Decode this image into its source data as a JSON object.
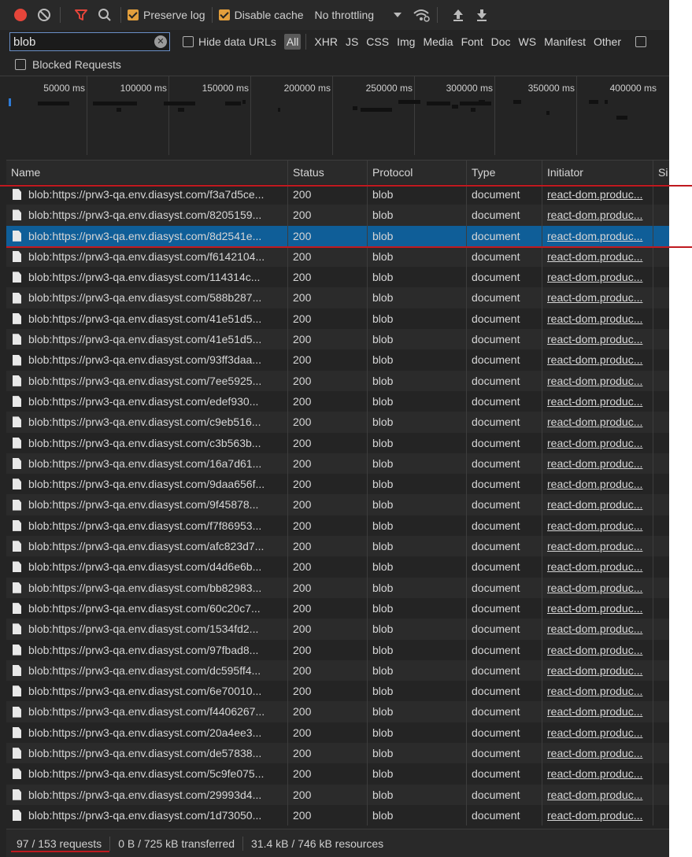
{
  "toolbar": {
    "preserve_log": "Preserve log",
    "disable_cache": "Disable cache",
    "throttling": "No throttling"
  },
  "filter": {
    "value": "blob",
    "hide_data_urls": "Hide data URLs",
    "types": [
      "All",
      "XHR",
      "JS",
      "CSS",
      "Img",
      "Media",
      "Font",
      "Doc",
      "WS",
      "Manifest",
      "Other"
    ],
    "blocked_requests": "Blocked Requests"
  },
  "overview": {
    "ticks": [
      "50000 ms",
      "100000 ms",
      "150000 ms",
      "200000 ms",
      "250000 ms",
      "300000 ms",
      "350000 ms",
      "400000 ms"
    ]
  },
  "columns": {
    "name": "Name",
    "status": "Status",
    "protocol": "Protocol",
    "type": "Type",
    "initiator": "Initiator",
    "size": "Si"
  },
  "rows": [
    {
      "name": "blob:https://prw3-qa.env.diasyst.com/f3a7d5ce...",
      "status": "200",
      "protocol": "blob",
      "type": "document",
      "initiator": "react-dom.produc..."
    },
    {
      "name": "blob:https://prw3-qa.env.diasyst.com/8205159...",
      "status": "200",
      "protocol": "blob",
      "type": "document",
      "initiator": "react-dom.produc..."
    },
    {
      "name": "blob:https://prw3-qa.env.diasyst.com/8d2541e...",
      "status": "200",
      "protocol": "blob",
      "type": "document",
      "initiator": "react-dom.produc..."
    },
    {
      "name": "blob:https://prw3-qa.env.diasyst.com/f6142104...",
      "status": "200",
      "protocol": "blob",
      "type": "document",
      "initiator": "react-dom.produc..."
    },
    {
      "name": "blob:https://prw3-qa.env.diasyst.com/114314c...",
      "status": "200",
      "protocol": "blob",
      "type": "document",
      "initiator": "react-dom.produc..."
    },
    {
      "name": "blob:https://prw3-qa.env.diasyst.com/588b287...",
      "status": "200",
      "protocol": "blob",
      "type": "document",
      "initiator": "react-dom.produc..."
    },
    {
      "name": "blob:https://prw3-qa.env.diasyst.com/41e51d5...",
      "status": "200",
      "protocol": "blob",
      "type": "document",
      "initiator": "react-dom.produc..."
    },
    {
      "name": "blob:https://prw3-qa.env.diasyst.com/41e51d5...",
      "status": "200",
      "protocol": "blob",
      "type": "document",
      "initiator": "react-dom.produc..."
    },
    {
      "name": "blob:https://prw3-qa.env.diasyst.com/93ff3daa...",
      "status": "200",
      "protocol": "blob",
      "type": "document",
      "initiator": "react-dom.produc..."
    },
    {
      "name": "blob:https://prw3-qa.env.diasyst.com/7ee5925...",
      "status": "200",
      "protocol": "blob",
      "type": "document",
      "initiator": "react-dom.produc..."
    },
    {
      "name": "blob:https://prw3-qa.env.diasyst.com/edef930...",
      "status": "200",
      "protocol": "blob",
      "type": "document",
      "initiator": "react-dom.produc..."
    },
    {
      "name": "blob:https://prw3-qa.env.diasyst.com/c9eb516...",
      "status": "200",
      "protocol": "blob",
      "type": "document",
      "initiator": "react-dom.produc..."
    },
    {
      "name": "blob:https://prw3-qa.env.diasyst.com/c3b563b...",
      "status": "200",
      "protocol": "blob",
      "type": "document",
      "initiator": "react-dom.produc..."
    },
    {
      "name": "blob:https://prw3-qa.env.diasyst.com/16a7d61...",
      "status": "200",
      "protocol": "blob",
      "type": "document",
      "initiator": "react-dom.produc..."
    },
    {
      "name": "blob:https://prw3-qa.env.diasyst.com/9daa656f...",
      "status": "200",
      "protocol": "blob",
      "type": "document",
      "initiator": "react-dom.produc..."
    },
    {
      "name": "blob:https://prw3-qa.env.diasyst.com/9f45878...",
      "status": "200",
      "protocol": "blob",
      "type": "document",
      "initiator": "react-dom.produc..."
    },
    {
      "name": "blob:https://prw3-qa.env.diasyst.com/f7f86953...",
      "status": "200",
      "protocol": "blob",
      "type": "document",
      "initiator": "react-dom.produc..."
    },
    {
      "name": "blob:https://prw3-qa.env.diasyst.com/afc823d7...",
      "status": "200",
      "protocol": "blob",
      "type": "document",
      "initiator": "react-dom.produc..."
    },
    {
      "name": "blob:https://prw3-qa.env.diasyst.com/d4d6e6b...",
      "status": "200",
      "protocol": "blob",
      "type": "document",
      "initiator": "react-dom.produc..."
    },
    {
      "name": "blob:https://prw3-qa.env.diasyst.com/bb82983...",
      "status": "200",
      "protocol": "blob",
      "type": "document",
      "initiator": "react-dom.produc..."
    },
    {
      "name": "blob:https://prw3-qa.env.diasyst.com/60c20c7...",
      "status": "200",
      "protocol": "blob",
      "type": "document",
      "initiator": "react-dom.produc..."
    },
    {
      "name": "blob:https://prw3-qa.env.diasyst.com/1534fd2...",
      "status": "200",
      "protocol": "blob",
      "type": "document",
      "initiator": "react-dom.produc..."
    },
    {
      "name": "blob:https://prw3-qa.env.diasyst.com/97fbad8...",
      "status": "200",
      "protocol": "blob",
      "type": "document",
      "initiator": "react-dom.produc..."
    },
    {
      "name": "blob:https://prw3-qa.env.diasyst.com/dc595ff4...",
      "status": "200",
      "protocol": "blob",
      "type": "document",
      "initiator": "react-dom.produc..."
    },
    {
      "name": "blob:https://prw3-qa.env.diasyst.com/6e70010...",
      "status": "200",
      "protocol": "blob",
      "type": "document",
      "initiator": "react-dom.produc..."
    },
    {
      "name": "blob:https://prw3-qa.env.diasyst.com/f4406267...",
      "status": "200",
      "protocol": "blob",
      "type": "document",
      "initiator": "react-dom.produc..."
    },
    {
      "name": "blob:https://prw3-qa.env.diasyst.com/20a4ee3...",
      "status": "200",
      "protocol": "blob",
      "type": "document",
      "initiator": "react-dom.produc..."
    },
    {
      "name": "blob:https://prw3-qa.env.diasyst.com/de57838...",
      "status": "200",
      "protocol": "blob",
      "type": "document",
      "initiator": "react-dom.produc..."
    },
    {
      "name": "blob:https://prw3-qa.env.diasyst.com/5c9fe075...",
      "status": "200",
      "protocol": "blob",
      "type": "document",
      "initiator": "react-dom.produc..."
    },
    {
      "name": "blob:https://prw3-qa.env.diasyst.com/29993d4...",
      "status": "200",
      "protocol": "blob",
      "type": "document",
      "initiator": "react-dom.produc..."
    },
    {
      "name": "blob:https://prw3-qa.env.diasyst.com/1d73050...",
      "status": "200",
      "protocol": "blob",
      "type": "document",
      "initiator": "react-dom.produc..."
    }
  ],
  "selected_row": 2,
  "status_bar": {
    "requests": "97 / 153 requests",
    "transferred": "0 B / 725 kB transferred",
    "resources": "31.4 kB / 746 kB resources"
  },
  "colors": {
    "panel_bg": "#242424",
    "selected_row": "#0f5e98",
    "record_red": "#e5453a",
    "checkbox_orange": "#e39f3c",
    "annotation_red": "#c0191f"
  }
}
